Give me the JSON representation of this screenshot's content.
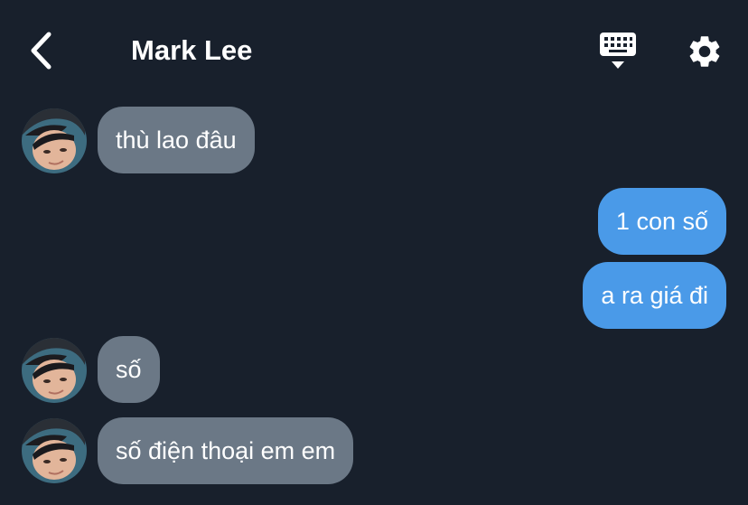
{
  "header": {
    "back_icon": "chevron-left-icon",
    "title": "Mark Lee",
    "keyboard_icon": "keyboard-icon",
    "settings_icon": "gear-icon"
  },
  "colors": {
    "background": "#18202c",
    "incoming_bubble": "#6b7886",
    "outgoing_bubble": "#4a9ae8",
    "text": "#ffffff"
  },
  "messages": [
    {
      "from": "contact",
      "text": "thù lao đâu"
    },
    {
      "from": "me",
      "text": "1 con số"
    },
    {
      "from": "me",
      "text": "a ra giá đi"
    },
    {
      "from": "contact",
      "text": "số"
    },
    {
      "from": "contact",
      "text": "số điện thoại em em"
    }
  ]
}
